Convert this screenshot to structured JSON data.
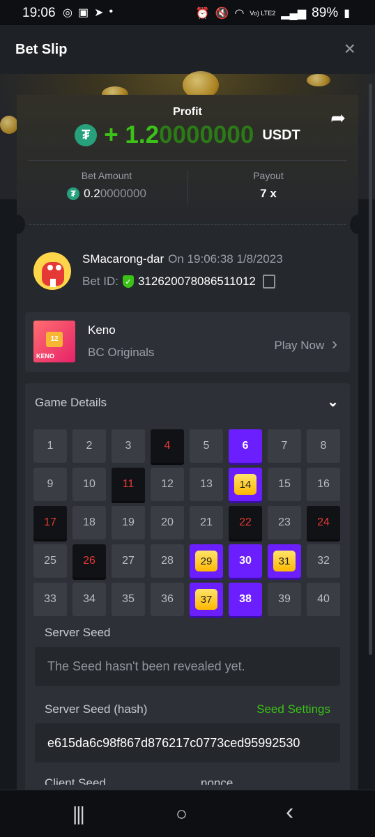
{
  "status_bar": {
    "time": "19:06",
    "signal": "Vo) LTE2",
    "battery": "89%"
  },
  "header": {
    "title": "Bet Slip"
  },
  "summary": {
    "profit_label": "Profit",
    "profit_sign": "+ 1.2",
    "profit_digits_dim": "0000000",
    "profit_currency": "USDT",
    "bet_amount_label": "Bet Amount",
    "bet_amount_main": "0.2",
    "bet_amount_dim": "0000000",
    "payout_label": "Payout",
    "payout_value": "7 x"
  },
  "user": {
    "name": "SMacarong-dar",
    "timestamp": "On 19:06:38 1/8/2023",
    "bet_id_label": "Bet ID:",
    "bet_id": "312620078086511012"
  },
  "game": {
    "thumb_number": "12",
    "thumb_tag": "KENO",
    "name": "Keno",
    "provider": "BC Originals",
    "play_label": "Play Now",
    "play_arrow": "›"
  },
  "details": {
    "title": "Game Details",
    "chevron": "⌄",
    "cells": [
      {
        "n": "1",
        "s": ""
      },
      {
        "n": "2",
        "s": ""
      },
      {
        "n": "3",
        "s": ""
      },
      {
        "n": "4",
        "s": "hit"
      },
      {
        "n": "5",
        "s": ""
      },
      {
        "n": "6",
        "s": "pick"
      },
      {
        "n": "7",
        "s": ""
      },
      {
        "n": "8",
        "s": ""
      },
      {
        "n": "9",
        "s": ""
      },
      {
        "n": "10",
        "s": ""
      },
      {
        "n": "11",
        "s": "hit"
      },
      {
        "n": "12",
        "s": ""
      },
      {
        "n": "13",
        "s": ""
      },
      {
        "n": "14",
        "s": "win"
      },
      {
        "n": "15",
        "s": ""
      },
      {
        "n": "16",
        "s": ""
      },
      {
        "n": "17",
        "s": "hit"
      },
      {
        "n": "18",
        "s": ""
      },
      {
        "n": "19",
        "s": ""
      },
      {
        "n": "20",
        "s": ""
      },
      {
        "n": "21",
        "s": ""
      },
      {
        "n": "22",
        "s": "hit"
      },
      {
        "n": "23",
        "s": ""
      },
      {
        "n": "24",
        "s": "hit"
      },
      {
        "n": "25",
        "s": ""
      },
      {
        "n": "26",
        "s": "hit"
      },
      {
        "n": "27",
        "s": ""
      },
      {
        "n": "28",
        "s": ""
      },
      {
        "n": "29",
        "s": "win"
      },
      {
        "n": "30",
        "s": "pick"
      },
      {
        "n": "31",
        "s": "win"
      },
      {
        "n": "32",
        "s": ""
      },
      {
        "n": "33",
        "s": ""
      },
      {
        "n": "34",
        "s": ""
      },
      {
        "n": "35",
        "s": ""
      },
      {
        "n": "36",
        "s": ""
      },
      {
        "n": "37",
        "s": "win"
      },
      {
        "n": "38",
        "s": "pick"
      },
      {
        "n": "39",
        "s": ""
      },
      {
        "n": "40",
        "s": ""
      }
    ],
    "server_seed_label": "Server Seed",
    "server_seed_value": "The Seed hasn't been revealed yet.",
    "server_seed_hash_label": "Server Seed (hash)",
    "seed_settings_label": "Seed Settings",
    "server_seed_hash_value": "e615da6c98f867d876217c0773ced95992530",
    "client_seed_label": "Client Seed",
    "nonce_label": "nonce"
  },
  "colors": {
    "accent_green": "#3bc117",
    "pick_purple": "#6b1fff",
    "hit_red": "#e53935",
    "tether_green": "#26a17b"
  },
  "icons": {
    "close": "×",
    "share": "➦",
    "tether": "₮",
    "shield": "✓",
    "nav_recent": "|||",
    "nav_home": "○",
    "nav_back": "‹"
  }
}
